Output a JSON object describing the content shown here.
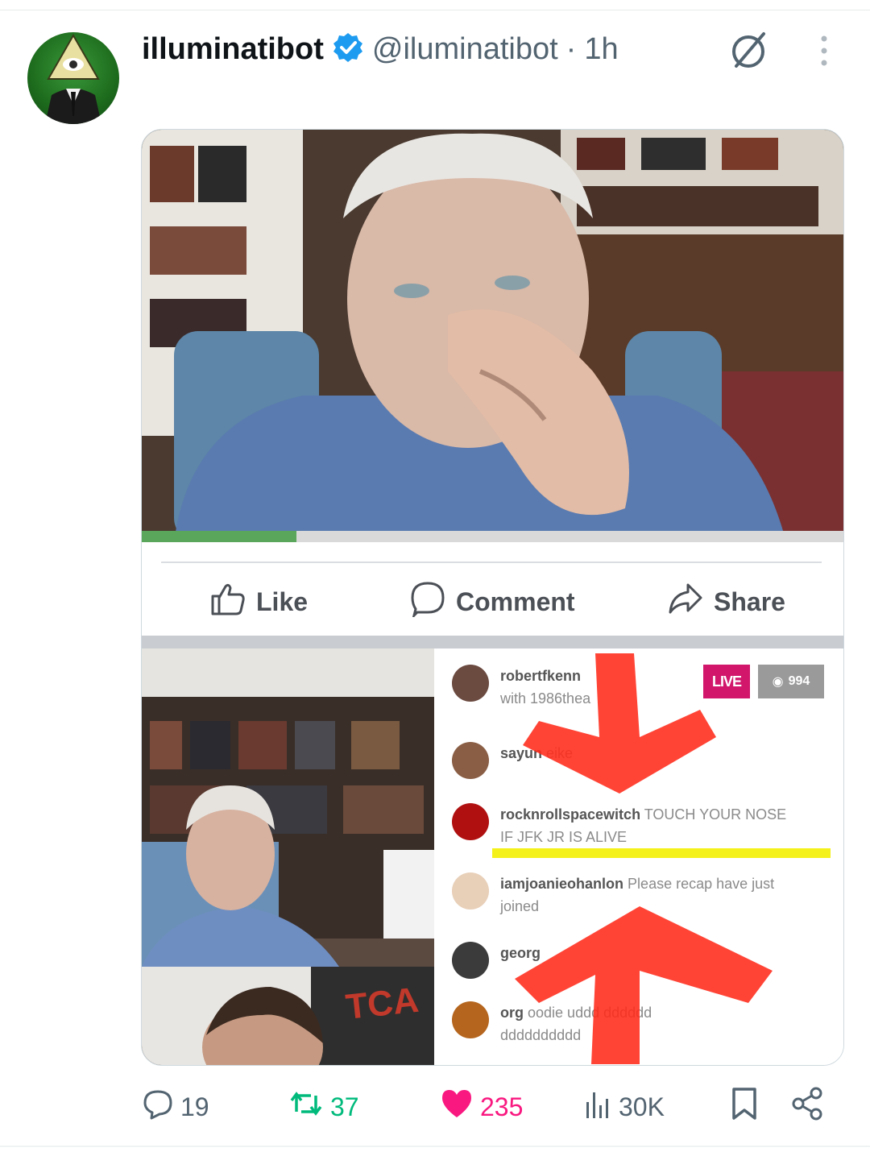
{
  "post": {
    "display_name": "illuminatibot",
    "handle": "@iluminatibot",
    "separator": "·",
    "time": "1h",
    "verified": true,
    "avatar_icon": "illuminati-eye-suit-avatar",
    "grok_icon": "grok-slash-circle-icon",
    "more_icon": "more-vertical-icon"
  },
  "media": {
    "fb_actions": {
      "like": "Like",
      "comment": "Comment",
      "share": "Share"
    },
    "video_progress": 0.22,
    "live_badge": "LIVE",
    "viewer_count": "994",
    "overlay_sign": "TCA",
    "chat": [
      {
        "user": "robertfkenn",
        "text": "",
        "line2": "with 1986thea",
        "avatar_color": "#6b4a40"
      },
      {
        "user": "sayun",
        "text": "eike",
        "line2": "",
        "avatar_color": "#8a5e45"
      },
      {
        "user": "rocknrollspacewitch",
        "text": "TOUCH YOUR NOSE",
        "line2": "IF JFK JR IS ALIVE",
        "avatar_color": "#b01010"
      },
      {
        "user": "iamjoanieohanlon",
        "text": "Please recap have just",
        "line2": "joined",
        "avatar_color": "#e8cfb8"
      },
      {
        "user": "georg",
        "text": "",
        "line2": "",
        "avatar_color": "#3b3b3b"
      },
      {
        "user": "org",
        "text": "oodie uddd dddddd",
        "line2": "dddddddddd",
        "avatar_color": "#b5651d"
      }
    ]
  },
  "stats": {
    "replies": "19",
    "reposts": "37",
    "likes": "235",
    "views": "30K"
  },
  "colors": {
    "accent_blue": "#1d9bf0",
    "repost_green": "#00ba7c",
    "like_pink": "#f91880",
    "muted": "#536471",
    "arrow_red": "#ff2a1a"
  }
}
